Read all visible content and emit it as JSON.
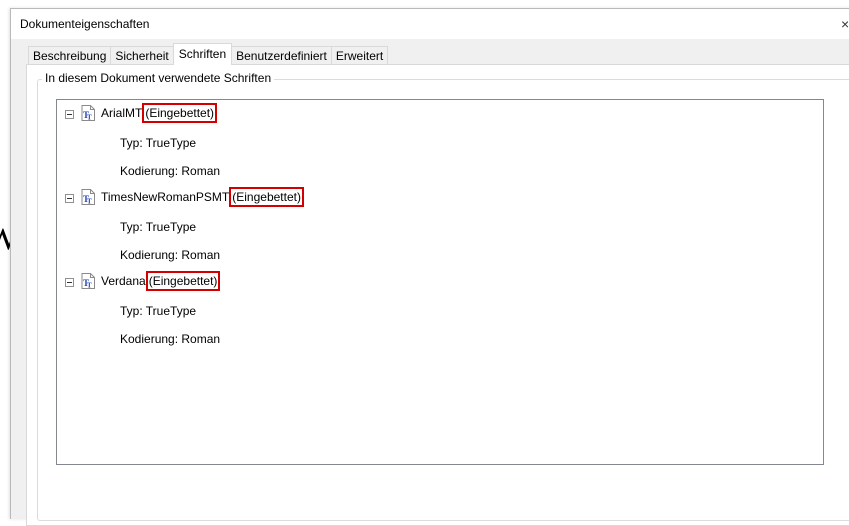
{
  "window": {
    "title": "Dokumenteigenschaften",
    "close_glyph": "×"
  },
  "tabs": [
    {
      "label": "Beschreibung",
      "active": false
    },
    {
      "label": "Sicherheit",
      "active": false
    },
    {
      "label": "Schriften",
      "active": true
    },
    {
      "label": "Benutzerdefiniert",
      "active": false
    },
    {
      "label": "Erweitert",
      "active": false
    }
  ],
  "fonts_group": {
    "legend": "In diesem Dokument verwendete Schriften"
  },
  "fonts": [
    {
      "name": "ArialMT",
      "status": "(Eingebettet)",
      "type": "Typ: TrueType",
      "encoding": "Kodierung: Roman"
    },
    {
      "name": "TimesNewRomanPSMT",
      "status": "(Eingebettet)",
      "type": "Typ: TrueType",
      "encoding": "Kodierung: Roman"
    },
    {
      "name": "Verdana",
      "status": "(Eingebettet)",
      "type": "Typ: TrueType",
      "encoding": "Kodierung: Roman"
    }
  ],
  "background": {
    "glyph": "W"
  },
  "colors": {
    "highlight": "#d40000",
    "icon_blue": "#1f3fbf"
  },
  "icons": {
    "font_item": "truetype-font-icon",
    "expander": "collapse-minus-icon",
    "close": "close-icon"
  }
}
